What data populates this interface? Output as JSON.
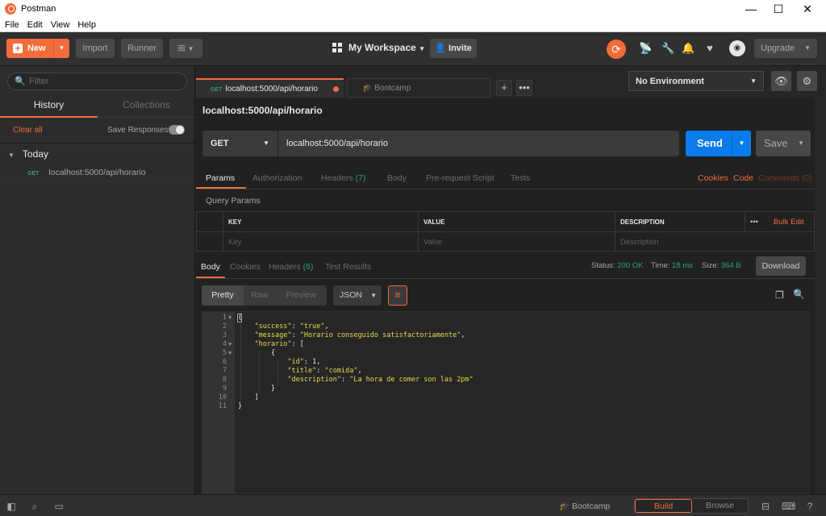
{
  "window": {
    "title": "Postman",
    "minimize": "—",
    "maximize": "☐",
    "close": "✕"
  },
  "menu": [
    "File",
    "Edit",
    "View",
    "Help"
  ],
  "header": {
    "new_label": "New",
    "import_label": "Import",
    "runner_label": "Runner",
    "workspace_label": "My Workspace",
    "invite_label": "Invite",
    "upgrade_label": "Upgrade"
  },
  "sidebar": {
    "filter_placeholder": "Filter",
    "tabs": [
      "History",
      "Collections"
    ],
    "clear_all": "Clear all",
    "save_responses": "Save Responses",
    "group": "Today",
    "items": [
      {
        "method": "GET",
        "url": "localhost:5000/api/horario"
      }
    ]
  },
  "tabs": [
    {
      "method": "GET",
      "label": "localhost:5000/api/horario"
    },
    {
      "label": "Bootcamp"
    }
  ],
  "environment": {
    "selected": "No Environment"
  },
  "request": {
    "title": "localhost:5000/api/horario",
    "method": "GET",
    "url": "localhost:5000/api/horario",
    "send_label": "Send",
    "save_label": "Save",
    "tabs": [
      "Params",
      "Authorization",
      "Headers",
      "Body",
      "Pre-request Script",
      "Tests"
    ],
    "headers_count": "(7)",
    "links": {
      "cookies": "Cookies",
      "code": "Code",
      "comments": "Comments (0)"
    },
    "query_params_title": "Query Params",
    "table": {
      "headers": [
        "KEY",
        "VALUE",
        "DESCRIPTION"
      ],
      "placeholders": [
        "Key",
        "Value",
        "Description"
      ],
      "more": "•••",
      "bulk_edit": "Bulk Edit"
    }
  },
  "response": {
    "tabs": [
      "Body",
      "Cookies",
      "Headers",
      "Test Results"
    ],
    "headers_count": "(6)",
    "status_label": "Status:",
    "status_value": "200 OK",
    "time_label": "Time:",
    "time_value": "18 ms",
    "size_label": "Size:",
    "size_value": "364 B",
    "download_label": "Download",
    "formats": [
      "Pretty",
      "Raw",
      "Preview"
    ],
    "language": "JSON",
    "lines": [
      "1",
      "2",
      "3",
      "4",
      "5",
      "6",
      "7",
      "8",
      "9",
      "10",
      "11"
    ],
    "code": {
      "l1": "{",
      "k_success": "\"success\"",
      "v_success": "\"true\"",
      "k_message": "\"message\"",
      "v_message": "\"Horario conseguido satisfactoriamente\"",
      "k_horario": "\"horario\"",
      "k_id": "\"id\"",
      "v_id": "1",
      "k_title": "\"title\"",
      "v_title": "\"comida\"",
      "k_desc": "\"description\"",
      "v_desc": "\"La hora de comer son las 2pm\""
    }
  },
  "statusbar": {
    "bootcamp": "Bootcamp",
    "build": "Build",
    "browse": "Browse"
  },
  "colors": {
    "accent": "#f26b3a",
    "send": "#097bed",
    "ok": "#2ea36b",
    "key": "#e6d94c"
  }
}
